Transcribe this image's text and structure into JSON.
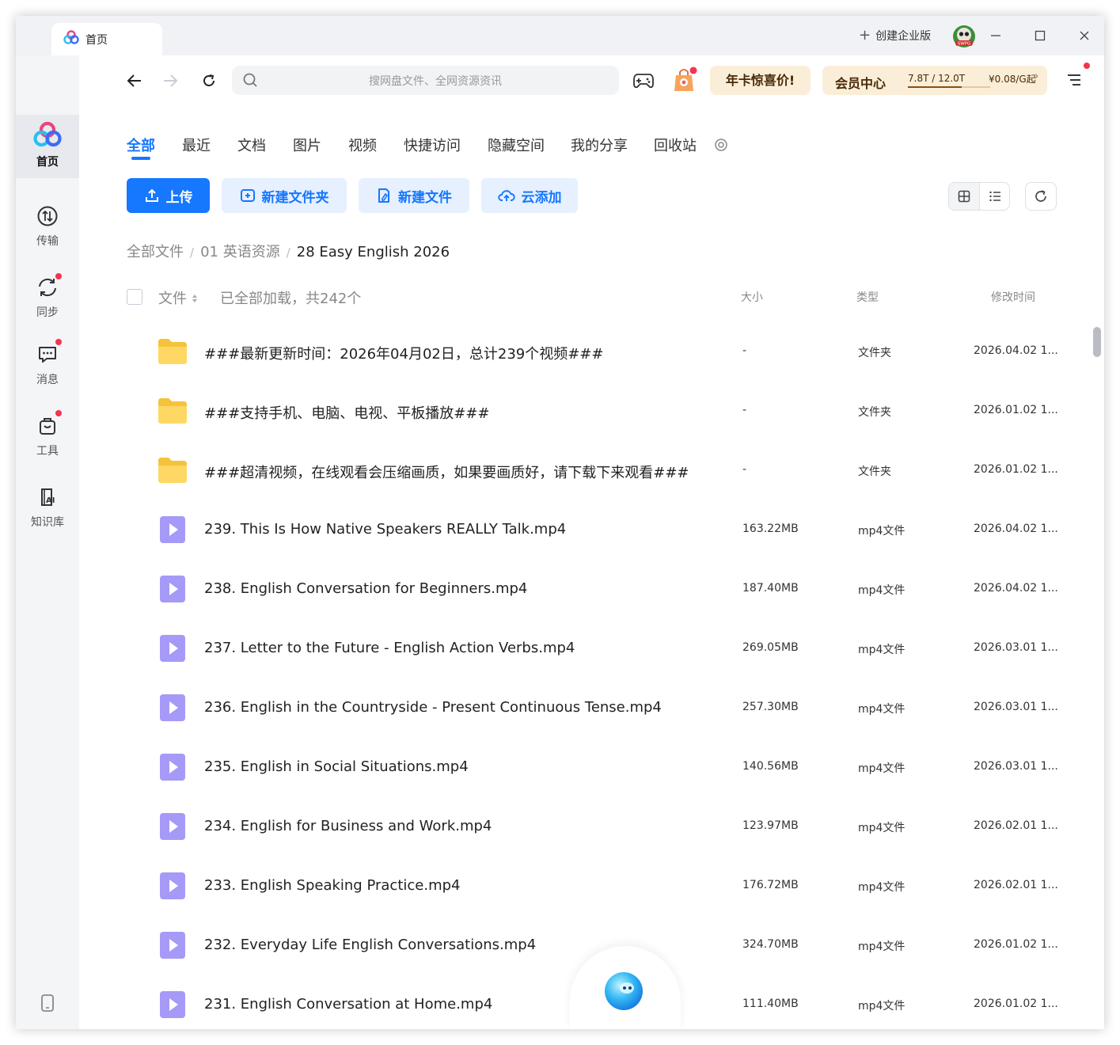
{
  "titlebar": {
    "tab_label": "首页",
    "create_enterprise": "创建企业版",
    "avatar_text": "SWPG"
  },
  "sidebar": {
    "items": [
      {
        "label": "首页",
        "icon": "baidu-netdisk-logo-icon",
        "active": true
      },
      {
        "label": "传输",
        "icon": "transfer-icon"
      },
      {
        "label": "同步",
        "icon": "sync-icon",
        "badge": true
      },
      {
        "label": "消息",
        "icon": "message-icon",
        "badge": true
      },
      {
        "label": "工具",
        "icon": "toolbox-icon",
        "badge": true
      },
      {
        "label": "知识库",
        "icon": "ai-knowledge-icon"
      }
    ],
    "bottom_icon": "phone-icon"
  },
  "toolbar": {
    "search_placeholder": "搜网盘文件、全网资源资讯",
    "promo_label": "年卡惊喜价!",
    "vip": {
      "title": "会员中心",
      "quota": "7.8T / 12.0T",
      "quota_fraction": 0.65,
      "price": "¥0.08/G起",
      "arrow": "›"
    }
  },
  "category_tabs": [
    "全部",
    "最近",
    "文档",
    "图片",
    "视频",
    "快捷访问",
    "隐藏空间",
    "我的分享",
    "回收站"
  ],
  "actions": {
    "upload": "上传",
    "new_folder": "新建文件夹",
    "new_file": "新建文件",
    "cloud_add": "云添加"
  },
  "breadcrumb": [
    "全部文件",
    "01 英语资源",
    "28 Easy English 2026"
  ],
  "list_header": {
    "file": "文件",
    "status": "已全部加载，共242个",
    "size": "大小",
    "type": "类型",
    "modified": "修改时间"
  },
  "files": [
    {
      "name": "###最新更新时间：2026年04月02日，总计239个视频###",
      "size": "-",
      "type": "文件夹",
      "modified": "2026.04.02 1...",
      "kind": "folder"
    },
    {
      "name": "###支持手机、电脑、电视、平板播放###",
      "size": "-",
      "type": "文件夹",
      "modified": "2026.01.02 1...",
      "kind": "folder"
    },
    {
      "name": "###超清视频，在线观看会压缩画质，如果要画质好，请下载下来观看###",
      "size": "-",
      "type": "文件夹",
      "modified": "2026.01.02 1...",
      "kind": "folder"
    },
    {
      "name": "239. This Is How Native Speakers REALLY Talk.mp4",
      "size": "163.22MB",
      "type": "mp4文件",
      "modified": "2026.04.02 1...",
      "kind": "video"
    },
    {
      "name": "238. English Conversation for Beginners.mp4",
      "size": "187.40MB",
      "type": "mp4文件",
      "modified": "2026.04.02 1...",
      "kind": "video"
    },
    {
      "name": "237. Letter to the Future - English Action Verbs.mp4",
      "size": "269.05MB",
      "type": "mp4文件",
      "modified": "2026.03.01 1...",
      "kind": "video"
    },
    {
      "name": "236. English in the Countryside - Present Continuous Tense.mp4",
      "size": "257.30MB",
      "type": "mp4文件",
      "modified": "2026.03.01 1...",
      "kind": "video"
    },
    {
      "name": "235. English in Social Situations.mp4",
      "size": "140.56MB",
      "type": "mp4文件",
      "modified": "2026.03.01 1...",
      "kind": "video"
    },
    {
      "name": "234. English for Business and Work.mp4",
      "size": "123.97MB",
      "type": "mp4文件",
      "modified": "2026.02.01 1...",
      "kind": "video"
    },
    {
      "name": "233. English Speaking Practice.mp4",
      "size": "176.72MB",
      "type": "mp4文件",
      "modified": "2026.02.01 1...",
      "kind": "video"
    },
    {
      "name": "232. Everyday Life English Conversations.mp4",
      "size": "324.70MB",
      "type": "mp4文件",
      "modified": "2026.01.02 1...",
      "kind": "video"
    },
    {
      "name": "231. English Conversation at Home.mp4",
      "size": "111.40MB",
      "type": "mp4文件",
      "modified": "2026.01.02 1...",
      "kind": "video"
    }
  ],
  "colors": {
    "accent": "#1677ff",
    "accent_light": "#e6f0ff",
    "promo_bg": "#fbeed8",
    "badge": "#f5334f",
    "folder": "#ffd35c",
    "video": "#9a8cf7"
  }
}
